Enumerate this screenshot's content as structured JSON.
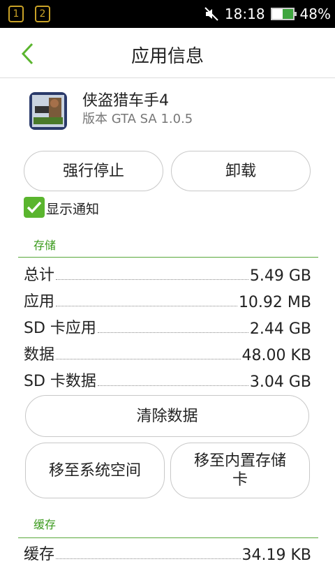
{
  "status_bar": {
    "notif1": "1",
    "notif2": "2",
    "time": "18:18",
    "battery_text": "48%",
    "battery_level": 0.48
  },
  "header": {
    "title": "应用信息"
  },
  "app": {
    "name": "侠盗猎车手4",
    "version": "版本 GTA SA 1.0.5"
  },
  "actions": {
    "force_stop": "强行停止",
    "uninstall": "卸载"
  },
  "notifications": {
    "label": "显示通知",
    "checked": true
  },
  "storage": {
    "title": "存储",
    "rows": [
      {
        "label": "总计",
        "value": "5.49 GB"
      },
      {
        "label": "应用",
        "value": "10.92 MB"
      },
      {
        "label": "SD 卡应用",
        "value": "2.44 GB"
      },
      {
        "label": "数据",
        "value": "48.00 KB"
      },
      {
        "label": "SD 卡数据",
        "value": "3.04 GB"
      }
    ],
    "clear_data": "清除数据",
    "move_to_system": "移至系统空间",
    "move_to_internal": "移至内置存储卡"
  },
  "cache": {
    "title": "缓存",
    "rows": [
      {
        "label": "缓存",
        "value": "34.19 KB"
      }
    ]
  },
  "colors": {
    "accent": "#5ab52e",
    "section": "#3a9a1c"
  }
}
